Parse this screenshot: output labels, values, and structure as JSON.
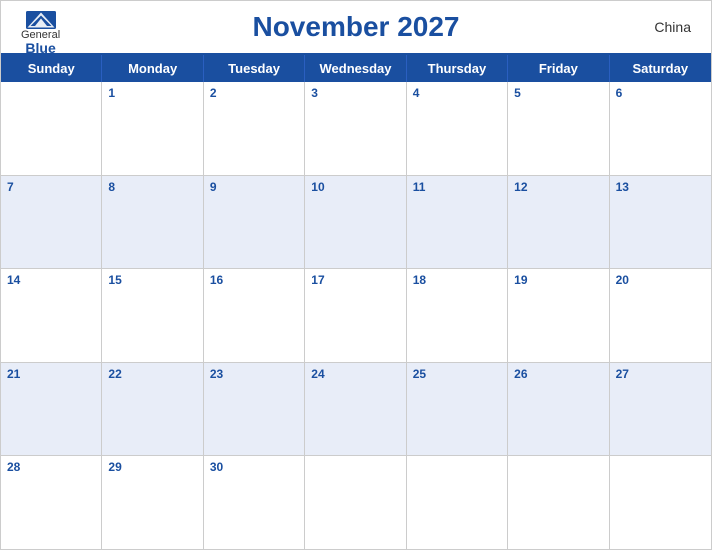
{
  "header": {
    "logo_general": "General",
    "logo_blue": "Blue",
    "title": "November 2027",
    "country": "China"
  },
  "day_headers": [
    "Sunday",
    "Monday",
    "Tuesday",
    "Wednesday",
    "Thursday",
    "Friday",
    "Saturday"
  ],
  "weeks": [
    [
      null,
      1,
      2,
      3,
      4,
      5,
      6
    ],
    [
      7,
      8,
      9,
      10,
      11,
      12,
      13
    ],
    [
      14,
      15,
      16,
      17,
      18,
      19,
      20
    ],
    [
      21,
      22,
      23,
      24,
      25,
      26,
      27
    ],
    [
      28,
      29,
      30,
      null,
      null,
      null,
      null
    ]
  ],
  "colors": {
    "primary_blue": "#1a4fa0",
    "header_bg": "#1a4fa0",
    "row_even": "#e8edf8",
    "row_odd": "#ffffff"
  }
}
